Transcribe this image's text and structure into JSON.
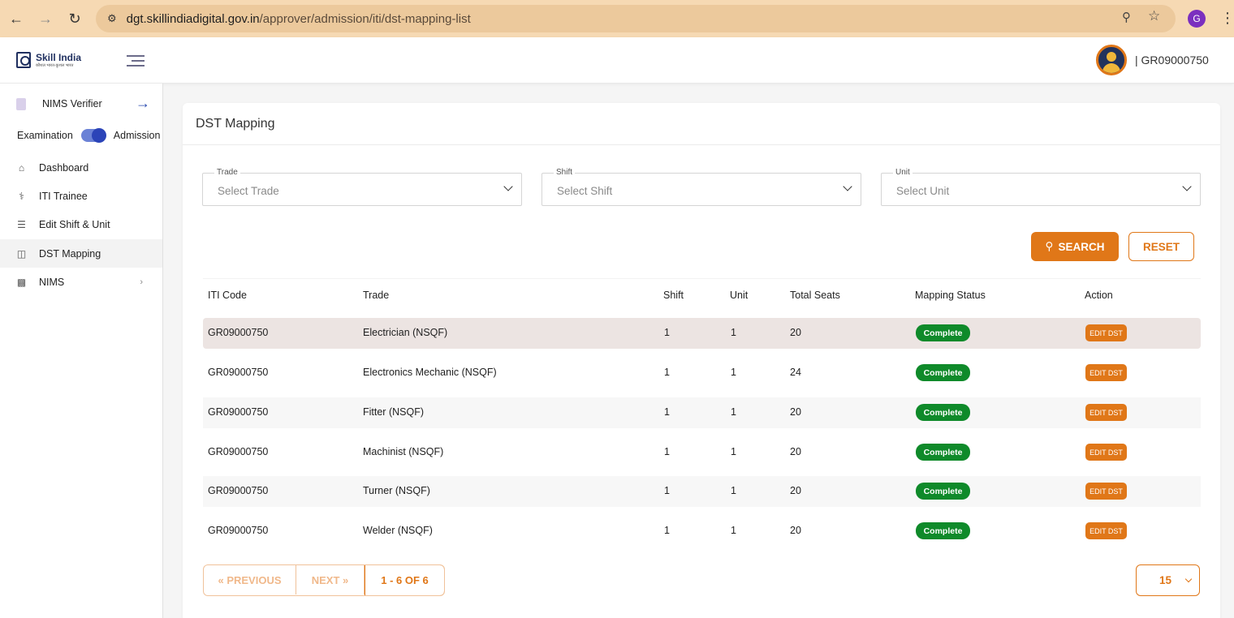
{
  "browser": {
    "url_host": "dgt.skillindiadigital.gov.in",
    "url_path": "/approver/admission/iti/dst-mapping-list",
    "profile_initial": "G"
  },
  "header": {
    "logo_title": "Skill India",
    "logo_subtitle": "कौशल भारत-कुशल भारत",
    "user_id": "| GR09000750"
  },
  "sidebar": {
    "role_label": "NIMS Verifier",
    "toggle_left": "Examination",
    "toggle_right": "Admission",
    "items": [
      {
        "label": "Dashboard",
        "icon": "home-icon"
      },
      {
        "label": "ITI Trainee",
        "icon": "trainee-icon"
      },
      {
        "label": "Edit Shift & Unit",
        "icon": "list-icon"
      },
      {
        "label": "DST Mapping",
        "icon": "mapping-icon",
        "active": true
      },
      {
        "label": "NIMS",
        "icon": "hierarchy-icon",
        "has_children": true
      }
    ]
  },
  "main": {
    "title": "DST Mapping",
    "filters": {
      "trade": {
        "label": "Trade",
        "placeholder": "Select Trade"
      },
      "shift": {
        "label": "Shift",
        "placeholder": "Select Shift"
      },
      "unit": {
        "label": "Unit",
        "placeholder": "Select Unit"
      }
    },
    "search_label": "SEARCH",
    "reset_label": "RESET",
    "table": {
      "columns": [
        "ITI Code",
        "Trade",
        "Shift",
        "Unit",
        "Total Seats",
        "Mapping Status",
        "Action"
      ],
      "rows": [
        {
          "iti_code": "GR09000750",
          "trade": "Electrician (NSQF)",
          "shift": "1",
          "unit": "1",
          "seats": "20",
          "status": "Complete",
          "action": "EDIT DST"
        },
        {
          "iti_code": "GR09000750",
          "trade": "Electronics Mechanic (NSQF)",
          "shift": "1",
          "unit": "1",
          "seats": "24",
          "status": "Complete",
          "action": "EDIT DST"
        },
        {
          "iti_code": "GR09000750",
          "trade": "Fitter (NSQF)",
          "shift": "1",
          "unit": "1",
          "seats": "20",
          "status": "Complete",
          "action": "EDIT DST"
        },
        {
          "iti_code": "GR09000750",
          "trade": "Machinist (NSQF)",
          "shift": "1",
          "unit": "1",
          "seats": "20",
          "status": "Complete",
          "action": "EDIT DST"
        },
        {
          "iti_code": "GR09000750",
          "trade": "Turner (NSQF)",
          "shift": "1",
          "unit": "1",
          "seats": "20",
          "status": "Complete",
          "action": "EDIT DST"
        },
        {
          "iti_code": "GR09000750",
          "trade": "Welder (NSQF)",
          "shift": "1",
          "unit": "1",
          "seats": "20",
          "status": "Complete",
          "action": "EDIT DST"
        }
      ]
    },
    "pagination": {
      "previous": "« PREVIOUS",
      "next": "NEXT »",
      "range": "1 - 6 OF 6",
      "page_size": "15"
    }
  },
  "colors": {
    "accent": "#e07718",
    "status_complete": "#0f8a2a",
    "browser_bar": "#f6d9b3"
  }
}
